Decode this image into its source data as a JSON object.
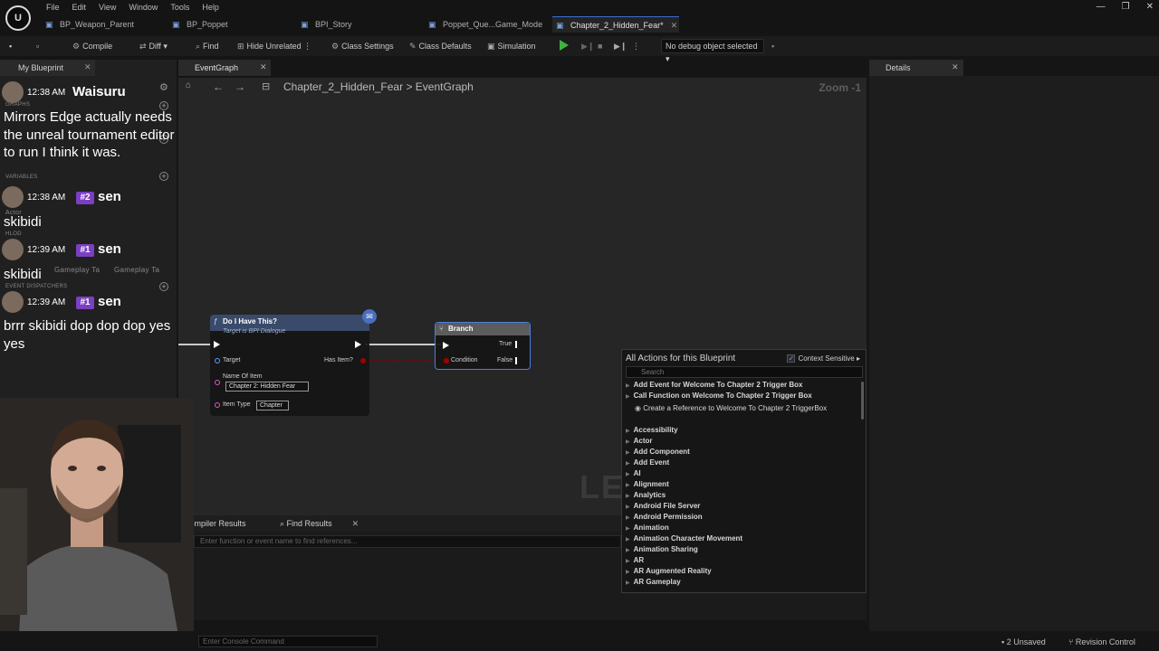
{
  "menu": [
    "File",
    "Edit",
    "View",
    "Window",
    "Tools",
    "Help"
  ],
  "tabs": [
    {
      "label": "BP_Weapon_Parent",
      "active": false
    },
    {
      "label": "BP_Poppet",
      "active": false
    },
    {
      "label": "BPI_Story",
      "active": false
    },
    {
      "label": "Poppet_Que...Game_Mode",
      "active": false
    },
    {
      "label": "Chapter_2_Hidden_Fear*",
      "active": true
    }
  ],
  "toolbar": {
    "compile": "Compile",
    "diff": "Diff",
    "find": "Find",
    "hide_unrelated": "Hide Unrelated",
    "class_settings": "Class Settings",
    "class_defaults": "Class Defaults",
    "simulation": "Simulation",
    "debug_object": "No debug object selected"
  },
  "my_blueprint": {
    "tab": "My Blueprint",
    "add": "Add",
    "sections": [
      "GRAPHS",
      "VARIABLES",
      "HLOD",
      "EVENT DISPATCHERS"
    ],
    "partial_labels": [
      "Actor",
      "Gameplay Ta",
      "Gameplay Ta"
    ]
  },
  "chat": [
    {
      "time": "12:38 AM",
      "name": "Waisuru",
      "badge": "",
      "text": "Mirrors Edge actually needs the unreal tournament editor to run I think it was."
    },
    {
      "time": "12:38 AM",
      "name": "sen",
      "badge": "#2",
      "text": "skibidi"
    },
    {
      "time": "12:39 AM",
      "name": "sen",
      "badge": "#1",
      "text": "skibidi"
    },
    {
      "time": "12:39 AM",
      "name": "sen",
      "badge": "#1",
      "text": "brrr skibidi dop dop dop yes yes"
    }
  ],
  "graph": {
    "tab": "EventGraph",
    "breadcrumb_root": "Chapter_2_Hidden_Fear",
    "breadcrumb_sep": ">",
    "breadcrumb_leaf": "EventGraph",
    "zoom": "Zoom -1",
    "watermark": "LEV"
  },
  "node_do_i_have": {
    "title": "Do I Have This?",
    "subtitle": "Target is BPI Dialogue",
    "target": "Target",
    "has_item": "Has Item?",
    "name_of_item_label": "Name Of Item",
    "name_of_item_value": "Chapter 2: Hidden Fear",
    "item_type_label": "Item Type",
    "item_type_value": "Chapter"
  },
  "node_branch": {
    "title": "Branch",
    "true": "True",
    "false": "False",
    "condition": "Condition"
  },
  "action_menu": {
    "title": "All Actions for this Blueprint",
    "context_sensitive": "Context Sensitive",
    "search_placeholder": "Search",
    "items": [
      {
        "label": "Add Event for Welcome To Chapter 2 Trigger Box",
        "kind": "tree"
      },
      {
        "label": "Call Function on Welcome To Chapter 2 Trigger Box",
        "kind": "tree"
      },
      {
        "label": "Create a Reference to Welcome To Chapter 2 TriggerBox",
        "kind": "leaf"
      },
      {
        "label": "Accessibility",
        "kind": "tree"
      },
      {
        "label": "Actor",
        "kind": "tree"
      },
      {
        "label": "Add Component",
        "kind": "tree"
      },
      {
        "label": "Add Event",
        "kind": "tree"
      },
      {
        "label": "AI",
        "kind": "tree"
      },
      {
        "label": "Alignment",
        "kind": "tree"
      },
      {
        "label": "Analytics",
        "kind": "tree"
      },
      {
        "label": "Android File Server",
        "kind": "tree"
      },
      {
        "label": "Android Permission",
        "kind": "tree"
      },
      {
        "label": "Animation",
        "kind": "tree"
      },
      {
        "label": "Animation Character Movement",
        "kind": "tree"
      },
      {
        "label": "Animation Sharing",
        "kind": "tree"
      },
      {
        "label": "AR",
        "kind": "tree"
      },
      {
        "label": "AR Augmented Reality",
        "kind": "tree"
      },
      {
        "label": "AR Gameplay",
        "kind": "tree"
      }
    ]
  },
  "bottom": {
    "compiler_results": "Compiler Results",
    "find_results": "Find Results",
    "find_placeholder": "Enter function or event name to find references..."
  },
  "details": {
    "tab": "Details"
  },
  "status": {
    "console_placeholder": "Enter Console Command",
    "unsaved": "2 Unsaved",
    "revision_control": "Revision Control"
  },
  "colors": {
    "accent_blue": "#3b6fd6",
    "function_header": "#3a4a6a",
    "branch_header": "#5c5c5c",
    "exec_wire": "#ffffff",
    "bool_wire": "#8b0000",
    "chat_badge": "#7a3fc2"
  }
}
